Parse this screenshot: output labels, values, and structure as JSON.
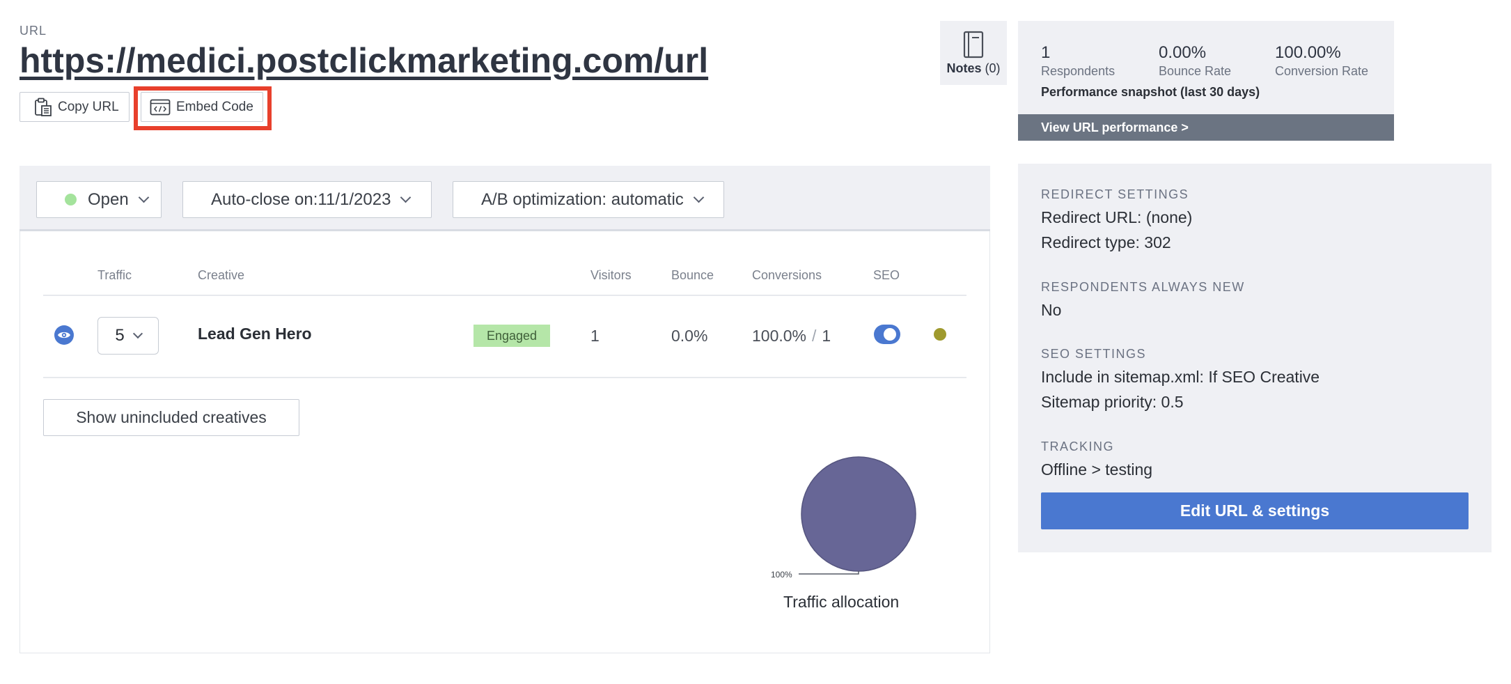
{
  "header": {
    "url_label": "URL",
    "url": "https://medici.postclickmarketing.com/url",
    "copy_url_label": "Copy URL",
    "embed_code_label": "Embed Code"
  },
  "notes": {
    "label": "Notes",
    "count": "(0)",
    "icon": "notebook-icon"
  },
  "performance": {
    "respondents_value": "1",
    "respondents_label": "Respondents",
    "bounce_value": "0.00%",
    "bounce_label": "Bounce Rate",
    "conversion_value": "100.00%",
    "conversion_label": "Conversion Rate",
    "title": "Performance snapshot (last 30 days)",
    "link_label": "View URL performance >"
  },
  "toolbar": {
    "status_label": "Open",
    "autoclose_label": "Auto-close on:11/1/2023",
    "ab_label": "A/B optimization: automatic"
  },
  "table": {
    "headers": {
      "traffic": "Traffic",
      "creative": "Creative",
      "visitors": "Visitors",
      "bounce": "Bounce",
      "conversions": "Conversions",
      "seo": "SEO"
    },
    "rows": [
      {
        "traffic": "5",
        "creative": "Lead Gen Hero",
        "badge": "Engaged",
        "visitors": "1",
        "bounce": "0.0%",
        "conversion_rate": "100.0%",
        "conversion_sep": "/",
        "conversion_count": "1",
        "seo_enabled": true
      }
    ],
    "show_uncluded_label": "Show unincluded creatives"
  },
  "chart_data": {
    "type": "pie",
    "categories": [
      "Lead Gen Hero"
    ],
    "values": [
      100
    ],
    "slice_labels": [
      "100%"
    ],
    "title": "Traffic allocation",
    "colors": [
      "#676696"
    ]
  },
  "settings": {
    "redirect_heading": "REDIRECT SETTINGS",
    "redirect_url": "Redirect URL: (none)",
    "redirect_type": "Redirect type: 302",
    "respondents_heading": "RESPONDENTS ALWAYS NEW",
    "respondents_value": "No",
    "seo_heading": "SEO SETTINGS",
    "seo_sitemap": "Include in sitemap.xml: If SEO Creative",
    "seo_priority": "Sitemap priority: 0.5",
    "tracking_heading": "TRACKING",
    "tracking_value": "Offline > testing",
    "edit_label": "Edit URL & settings"
  },
  "colors": {
    "accent": "#4a78d0",
    "highlight": "#e8402c",
    "status_open": "#a4e39c",
    "engaged_badge": "#b5e6a8",
    "creative_dot": "#9f9a2e"
  }
}
